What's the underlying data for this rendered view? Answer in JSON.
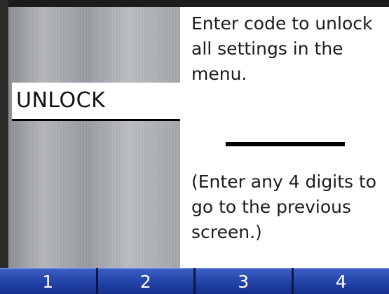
{
  "screen": {
    "title": "UNLOCK",
    "instruction": "Enter code to unlock all settings in the menu.",
    "code_value": "",
    "hint": "(Enter any 4 digits to go to the previous screen.)"
  },
  "softkeys": [
    {
      "label": "1"
    },
    {
      "label": "2"
    },
    {
      "label": "3"
    },
    {
      "label": "4"
    }
  ],
  "colors": {
    "panel": "#ffffff",
    "softkey": "#2647ad",
    "text": "#1c1c1c"
  }
}
